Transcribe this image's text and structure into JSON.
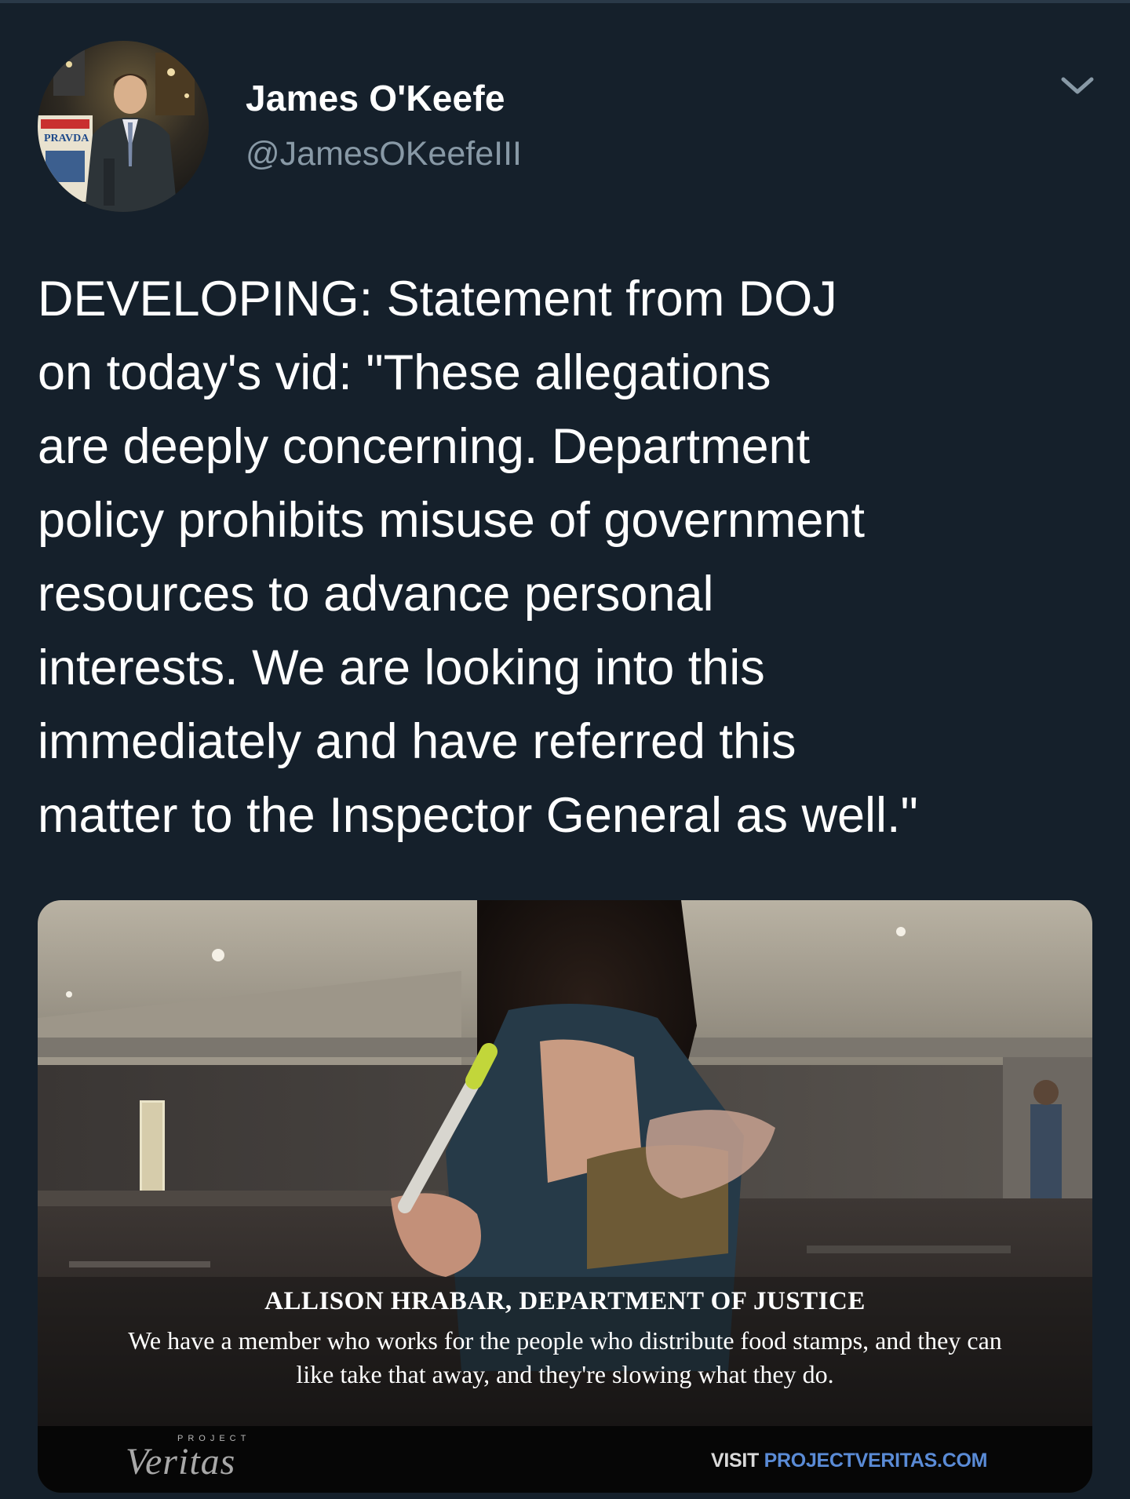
{
  "author": {
    "name": "James O'Keefe",
    "handle": "@JamesOKeefeIII",
    "avatar_icon": "profile-photo",
    "avatar_sign_text": "PRAVDA"
  },
  "menu_icon": "chevron-down-icon",
  "tweet": {
    "lines": [
      "DEVELOPING: Statement from DOJ",
      "on today's vid: \"These allegations",
      "are deeply concerning. Department",
      "policy prohibits misuse of government",
      "resources to advance personal",
      "interests. We are looking into this",
      "immediately and have referred this",
      "matter to the Inspector General as well.\""
    ]
  },
  "media": {
    "caption_name": "ALLISON HRABAR, DEPARTMENT OF JUSTICE",
    "caption_lines": [
      "We have a member who works for the people who distribute food stamps, and they can",
      "like take that away, and they're slowing what they do."
    ],
    "brand_kicker": "PROJECT",
    "brand_name": "Veritas",
    "visit_prefix": "VISIT ",
    "visit_domain": "PROJECTVERITAS.COM"
  },
  "colors": {
    "background": "#15202b",
    "handle": "#8899a6",
    "text": "#ffffff",
    "link_blue": "#5a8bd6"
  }
}
